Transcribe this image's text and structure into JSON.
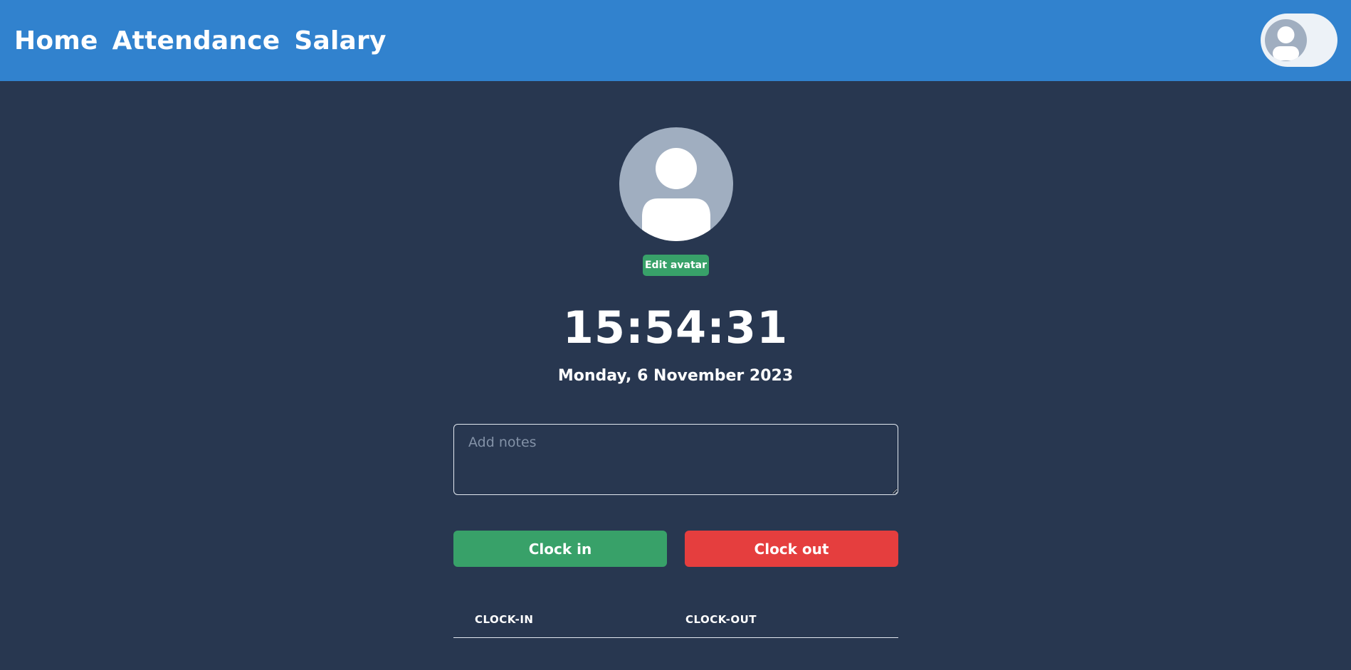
{
  "nav": {
    "items": [
      {
        "label": "Home"
      },
      {
        "label": "Attendance"
      },
      {
        "label": "Salary"
      }
    ]
  },
  "profile": {
    "edit_avatar_label": "Edit avatar"
  },
  "clock": {
    "time": "15:54:31",
    "date": "Monday, 6 November 2023"
  },
  "notes": {
    "placeholder": "Add notes",
    "value": ""
  },
  "actions": {
    "clock_in_label": "Clock in",
    "clock_out_label": "Clock out"
  },
  "table": {
    "columns": [
      "CLOCK-IN",
      "CLOCK-OUT"
    ],
    "rows": []
  },
  "colors": {
    "header": "#3182ce",
    "background": "#283750",
    "success": "#38a169",
    "danger": "#e53e3e",
    "avatar": "#a0aec0"
  },
  "icons": {
    "header_avatar": "user-icon",
    "profile_avatar": "user-icon"
  }
}
